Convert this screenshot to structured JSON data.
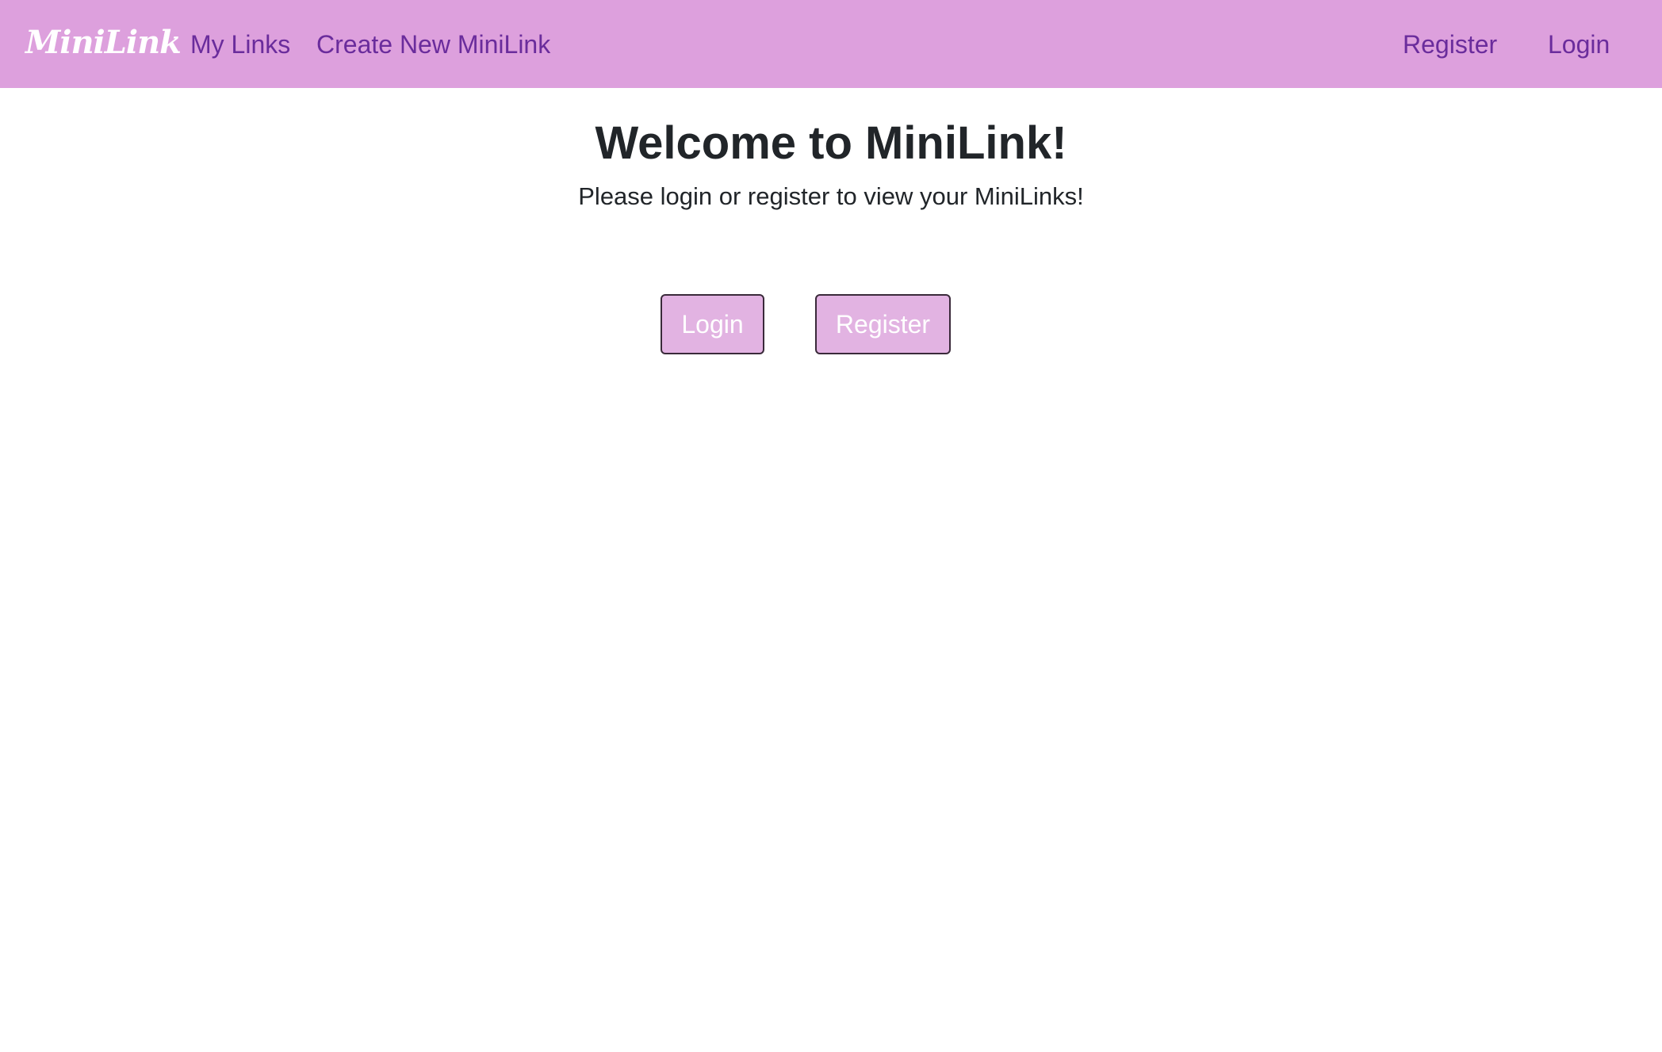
{
  "nav": {
    "brand": "MiniLink",
    "links": {
      "my_links": "My Links",
      "create_new": "Create New MiniLink",
      "register": "Register",
      "login": "Login"
    }
  },
  "main": {
    "title": "Welcome to MiniLink!",
    "subtitle": "Please login or register to view your MiniLinks!",
    "buttons": {
      "login": "Login",
      "register": "Register"
    }
  },
  "colors": {
    "navbar_bg": "#dda0dd",
    "nav_link": "#6a2c9c",
    "button_bg": "#e2b3e2",
    "text": "#212529"
  }
}
